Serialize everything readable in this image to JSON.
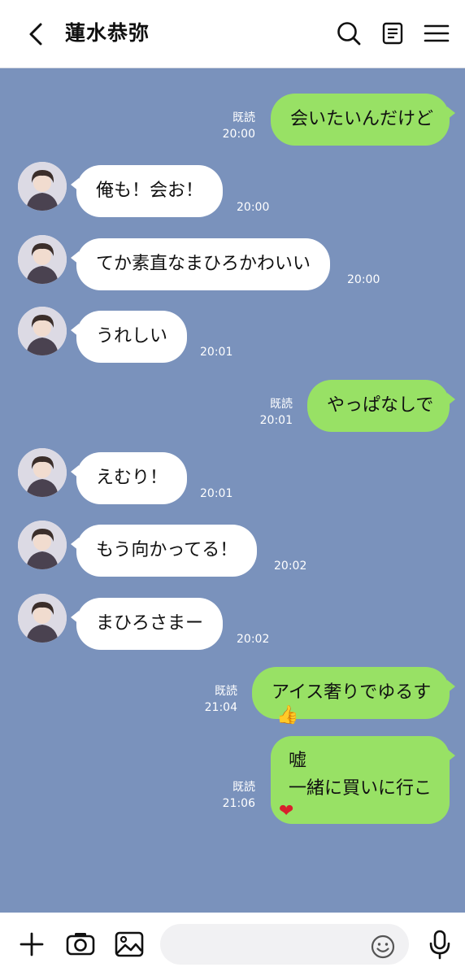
{
  "header": {
    "title": "蓮水恭弥",
    "icons": [
      "back-chevron-icon",
      "search-icon",
      "notes-icon",
      "menu-icon"
    ]
  },
  "messages": [
    {
      "side": "out",
      "text": "会いたいんだけど",
      "read": "既読",
      "time": "20:00"
    },
    {
      "side": "in",
      "text": "俺も！会お！",
      "time": "20:00"
    },
    {
      "side": "in",
      "text": "てか素直なまひろかわいい",
      "time": "20:00"
    },
    {
      "side": "in",
      "text": "うれしい",
      "time": "20:01"
    },
    {
      "side": "out",
      "text": "やっぱなしで",
      "read": "既読",
      "time": "20:01"
    },
    {
      "side": "in",
      "text": "えむり！",
      "time": "20:01"
    },
    {
      "side": "in",
      "text": "もう向かってる！",
      "time": "20:02"
    },
    {
      "side": "in",
      "text": "まひろさまー",
      "time": "20:02"
    },
    {
      "side": "out",
      "text": "アイス奢りでゆるす",
      "read": "既読",
      "time": "21:04",
      "emoji": "👍"
    },
    {
      "side": "out",
      "line1": "嘘",
      "line2": "一緒に買いに行こ",
      "read": "既読",
      "time": "21:06",
      "emoji": "❤"
    }
  ],
  "footer": {
    "input_value": "",
    "icons": [
      "plus-icon",
      "camera-icon",
      "image-icon",
      "emoji-icon",
      "microphone-icon"
    ]
  },
  "colors": {
    "background": "#7a92bc",
    "outgoing_bubble": "#98e165",
    "incoming_bubble": "#ffffff",
    "meta_text": "#ffffff"
  }
}
